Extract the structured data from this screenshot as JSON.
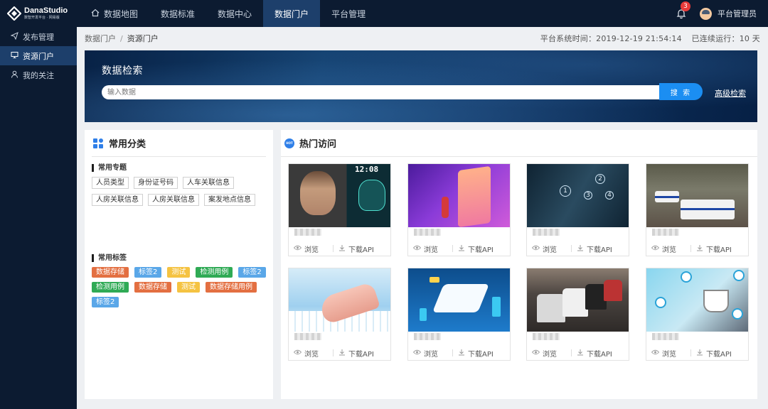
{
  "app": {
    "title": "DanaStudio",
    "subtitle": "数智开发平台 · 网易版"
  },
  "nav": {
    "items": [
      {
        "label": "数据地图",
        "active": false,
        "icon": "home-icon"
      },
      {
        "label": "数据标准",
        "active": false
      },
      {
        "label": "数据中心",
        "active": false
      },
      {
        "label": "数据门户",
        "active": true
      },
      {
        "label": "平台管理",
        "active": false
      }
    ],
    "notification_count": "3",
    "user_name": "平台管理员"
  },
  "sidebar": {
    "items": [
      {
        "label": "发布管理",
        "icon": "send-icon",
        "active": false
      },
      {
        "label": "资源门户",
        "icon": "monitor-icon",
        "active": true
      },
      {
        "label": "我的关注",
        "icon": "user-icon",
        "active": false
      }
    ]
  },
  "breadcrumb": {
    "root": "数据门户",
    "separator": "/",
    "current": "资源门户"
  },
  "system": {
    "time": "平台系统时间：2019-12-19 21:54:14",
    "uptime": "已连续运行：10 天"
  },
  "hero": {
    "title": "数据检索",
    "search_placeholder": "输入数据",
    "search_button": "搜 索",
    "advanced_link": "高级检索"
  },
  "categories": {
    "title": "常用分类",
    "topics_title": "常用专题",
    "topics": [
      "人员类型",
      "身份证号码",
      "人车关联信息",
      "人房关联信息",
      "人房关联信息",
      "案发地点信息"
    ],
    "tags_title": "常用标签",
    "tags": [
      {
        "label": "数据存储",
        "color": "#e36f41"
      },
      {
        "label": "标签2",
        "color": "#5aa7e8"
      },
      {
        "label": "测试",
        "color": "#f5c342"
      },
      {
        "label": "检测用例",
        "color": "#2faa55"
      },
      {
        "label": "标签2",
        "color": "#5aa7e8"
      },
      {
        "label": "检测用例",
        "color": "#2faa55"
      },
      {
        "label": "数据存储",
        "color": "#e36f41"
      },
      {
        "label": "测试",
        "color": "#f5c342"
      },
      {
        "label": "数据存储用例",
        "color": "#e36f41"
      },
      {
        "label": "标签2",
        "color": "#5aa7e8"
      }
    ]
  },
  "hot": {
    "title": "热门访问",
    "icon_text": "HOT",
    "browse_label": "浏览",
    "download_label": "下载API",
    "thumb_clock": "12:08",
    "thumb_numbers": [
      "1",
      "2",
      "3",
      "4"
    ]
  }
}
